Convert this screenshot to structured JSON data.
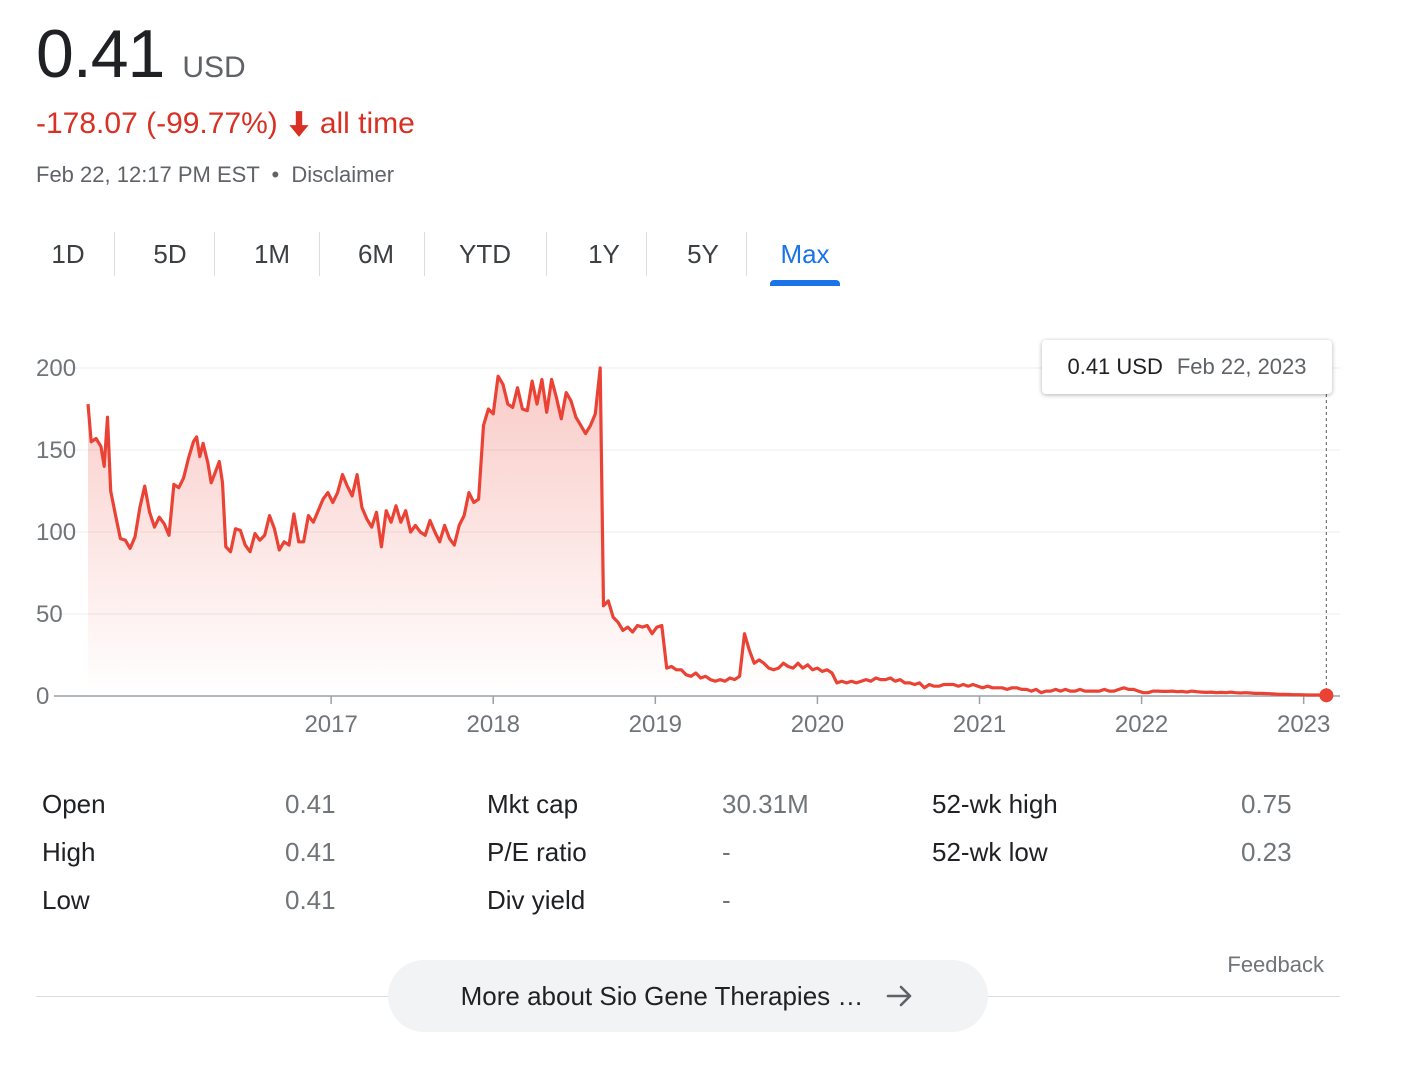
{
  "quote": {
    "price": "0.41",
    "currency": "USD",
    "change": "-178.07 (-99.77%)",
    "change_period": "all time",
    "timestamp": "Feb 22, 12:17 PM EST",
    "separator": "•",
    "disclaimer": "Disclaimer",
    "down_color": "#d93025"
  },
  "tabs": [
    {
      "label": "1D"
    },
    {
      "label": "5D"
    },
    {
      "label": "1M"
    },
    {
      "label": "6M"
    },
    {
      "label": "YTD"
    },
    {
      "label": "1Y"
    },
    {
      "label": "5Y"
    },
    {
      "label": "Max",
      "active": true
    }
  ],
  "tooltip": {
    "value": "0.41 USD",
    "date": "Feb 22, 2023"
  },
  "stats": [
    {
      "label": "Open",
      "value": "0.41"
    },
    {
      "label": "High",
      "value": "0.41"
    },
    {
      "label": "Low",
      "value": "0.41"
    },
    {
      "label": "Mkt cap",
      "value": "30.31M"
    },
    {
      "label": "P/E ratio",
      "value": "-"
    },
    {
      "label": "Div yield",
      "value": "-"
    },
    {
      "label": "52-wk high",
      "value": "0.75"
    },
    {
      "label": "52-wk low",
      "value": "0.23"
    }
  ],
  "footer": {
    "feedback": "Feedback",
    "more_button": "More about Sio Gene Therapies …",
    "arrow_icon": "arrow-right-icon"
  },
  "chart_data": {
    "type": "area",
    "title": "",
    "xlabel": "",
    "ylabel": "",
    "ylim": [
      0,
      200
    ],
    "xlim": [
      2015.5,
      2023.15
    ],
    "yticks": [
      0,
      50,
      100,
      150,
      200
    ],
    "xticks": [
      "2017",
      "2018",
      "2019",
      "2020",
      "2021",
      "2022",
      "2023"
    ],
    "grid": true,
    "line_color": "#ea4335",
    "series": [
      {
        "points": [
          [
            2015.5,
            178
          ],
          [
            2015.52,
            155
          ],
          [
            2015.55,
            157
          ],
          [
            2015.58,
            152
          ],
          [
            2015.6,
            140
          ],
          [
            2015.62,
            170
          ],
          [
            2015.64,
            125
          ],
          [
            2015.67,
            110
          ],
          [
            2015.7,
            96
          ],
          [
            2015.73,
            95
          ],
          [
            2015.76,
            90
          ],
          [
            2015.79,
            97
          ],
          [
            2015.82,
            115
          ],
          [
            2015.85,
            128
          ],
          [
            2015.88,
            112
          ],
          [
            2015.91,
            103
          ],
          [
            2015.94,
            109
          ],
          [
            2015.97,
            105
          ],
          [
            2016.0,
            98
          ],
          [
            2016.03,
            129
          ],
          [
            2016.06,
            127
          ],
          [
            2016.09,
            133
          ],
          [
            2016.12,
            145
          ],
          [
            2016.15,
            155
          ],
          [
            2016.17,
            158
          ],
          [
            2016.19,
            146
          ],
          [
            2016.21,
            154
          ],
          [
            2016.24,
            142
          ],
          [
            2016.26,
            130
          ],
          [
            2016.28,
            135
          ],
          [
            2016.31,
            143
          ],
          [
            2016.33,
            130
          ],
          [
            2016.35,
            91
          ],
          [
            2016.38,
            88
          ],
          [
            2016.41,
            102
          ],
          [
            2016.44,
            101
          ],
          [
            2016.47,
            92
          ],
          [
            2016.5,
            88
          ],
          [
            2016.53,
            99
          ],
          [
            2016.56,
            95
          ],
          [
            2016.59,
            98
          ],
          [
            2016.62,
            110
          ],
          [
            2016.65,
            102
          ],
          [
            2016.68,
            89
          ],
          [
            2016.71,
            94
          ],
          [
            2016.74,
            92
          ],
          [
            2016.77,
            111
          ],
          [
            2016.8,
            94
          ],
          [
            2016.83,
            94
          ],
          [
            2016.86,
            110
          ],
          [
            2016.89,
            106
          ],
          [
            2016.92,
            113
          ],
          [
            2016.95,
            120
          ],
          [
            2016.98,
            124
          ],
          [
            2017.01,
            118
          ],
          [
            2017.04,
            124
          ],
          [
            2017.07,
            135
          ],
          [
            2017.1,
            128
          ],
          [
            2017.13,
            122
          ],
          [
            2017.16,
            135
          ],
          [
            2017.19,
            115
          ],
          [
            2017.22,
            108
          ],
          [
            2017.25,
            103
          ],
          [
            2017.28,
            112
          ],
          [
            2017.31,
            91
          ],
          [
            2017.34,
            113
          ],
          [
            2017.37,
            106
          ],
          [
            2017.4,
            116
          ],
          [
            2017.43,
            106
          ],
          [
            2017.46,
            113
          ],
          [
            2017.49,
            100
          ],
          [
            2017.52,
            104
          ],
          [
            2017.55,
            100
          ],
          [
            2017.58,
            98
          ],
          [
            2017.61,
            107
          ],
          [
            2017.64,
            100
          ],
          [
            2017.67,
            94
          ],
          [
            2017.7,
            104
          ],
          [
            2017.73,
            96
          ],
          [
            2017.76,
            92
          ],
          [
            2017.79,
            104
          ],
          [
            2017.82,
            110
          ],
          [
            2017.85,
            124
          ],
          [
            2017.88,
            118
          ],
          [
            2017.91,
            120
          ],
          [
            2017.94,
            165
          ],
          [
            2017.97,
            175
          ],
          [
            2018.0,
            172
          ],
          [
            2018.03,
            195
          ],
          [
            2018.06,
            190
          ],
          [
            2018.09,
            178
          ],
          [
            2018.12,
            176
          ],
          [
            2018.15,
            188
          ],
          [
            2018.18,
            175
          ],
          [
            2018.21,
            174
          ],
          [
            2018.24,
            192
          ],
          [
            2018.27,
            178
          ],
          [
            2018.3,
            193
          ],
          [
            2018.33,
            173
          ],
          [
            2018.36,
            193
          ],
          [
            2018.39,
            182
          ],
          [
            2018.42,
            169
          ],
          [
            2018.45,
            185
          ],
          [
            2018.48,
            180
          ],
          [
            2018.51,
            170
          ],
          [
            2018.54,
            165
          ],
          [
            2018.57,
            160
          ],
          [
            2018.6,
            165
          ],
          [
            2018.63,
            172
          ],
          [
            2018.66,
            200
          ],
          [
            2018.68,
            55
          ],
          [
            2018.71,
            58
          ],
          [
            2018.74,
            48
          ],
          [
            2018.77,
            45
          ],
          [
            2018.8,
            40
          ],
          [
            2018.83,
            42
          ],
          [
            2018.86,
            39
          ],
          [
            2018.89,
            43
          ],
          [
            2018.92,
            42
          ],
          [
            2018.95,
            43
          ],
          [
            2018.98,
            38
          ],
          [
            2019.01,
            42
          ],
          [
            2019.04,
            43
          ],
          [
            2019.07,
            17
          ],
          [
            2019.1,
            18
          ],
          [
            2019.13,
            16
          ],
          [
            2019.16,
            16
          ],
          [
            2019.19,
            13
          ],
          [
            2019.22,
            12
          ],
          [
            2019.25,
            14
          ],
          [
            2019.28,
            11
          ],
          [
            2019.31,
            12
          ],
          [
            2019.34,
            10
          ],
          [
            2019.37,
            9
          ],
          [
            2019.4,
            10
          ],
          [
            2019.43,
            9
          ],
          [
            2019.46,
            11
          ],
          [
            2019.49,
            10
          ],
          [
            2019.52,
            12
          ],
          [
            2019.55,
            38
          ],
          [
            2019.58,
            28
          ],
          [
            2019.61,
            20
          ],
          [
            2019.64,
            22
          ],
          [
            2019.67,
            20
          ],
          [
            2019.7,
            17
          ],
          [
            2019.73,
            16
          ],
          [
            2019.76,
            17
          ],
          [
            2019.79,
            20
          ],
          [
            2019.82,
            18
          ],
          [
            2019.85,
            17
          ],
          [
            2019.88,
            20
          ],
          [
            2019.91,
            17
          ],
          [
            2019.94,
            19
          ],
          [
            2019.97,
            16
          ],
          [
            2020.0,
            17
          ],
          [
            2020.03,
            15
          ],
          [
            2020.06,
            16
          ],
          [
            2020.09,
            14
          ],
          [
            2020.12,
            8
          ],
          [
            2020.15,
            9
          ],
          [
            2020.18,
            8
          ],
          [
            2020.21,
            9
          ],
          [
            2020.24,
            8
          ],
          [
            2020.27,
            9
          ],
          [
            2020.3,
            10
          ],
          [
            2020.33,
            9
          ],
          [
            2020.36,
            11
          ],
          [
            2020.39,
            10
          ],
          [
            2020.42,
            10
          ],
          [
            2020.45,
            11
          ],
          [
            2020.48,
            9
          ],
          [
            2020.51,
            10
          ],
          [
            2020.54,
            8
          ],
          [
            2020.57,
            8
          ],
          [
            2020.6,
            7
          ],
          [
            2020.63,
            8
          ],
          [
            2020.66,
            5
          ],
          [
            2020.69,
            7
          ],
          [
            2020.72,
            6
          ],
          [
            2020.75,
            6
          ],
          [
            2020.78,
            7
          ],
          [
            2020.81,
            7
          ],
          [
            2020.84,
            7
          ],
          [
            2020.87,
            6
          ],
          [
            2020.9,
            7
          ],
          [
            2020.93,
            6
          ],
          [
            2020.96,
            7
          ],
          [
            2020.99,
            6
          ],
          [
            2021.02,
            5
          ],
          [
            2021.05,
            6
          ],
          [
            2021.08,
            5
          ],
          [
            2021.11,
            5
          ],
          [
            2021.14,
            5
          ],
          [
            2021.17,
            4
          ],
          [
            2021.2,
            5
          ],
          [
            2021.23,
            5
          ],
          [
            2021.26,
            4
          ],
          [
            2021.29,
            4
          ],
          [
            2021.32,
            3
          ],
          [
            2021.35,
            4
          ],
          [
            2021.38,
            2
          ],
          [
            2021.41,
            3
          ],
          [
            2021.44,
            3
          ],
          [
            2021.47,
            4
          ],
          [
            2021.5,
            3
          ],
          [
            2021.53,
            4
          ],
          [
            2021.56,
            3
          ],
          [
            2021.59,
            3
          ],
          [
            2021.62,
            4
          ],
          [
            2021.65,
            3
          ],
          [
            2021.68,
            3
          ],
          [
            2021.71,
            3
          ],
          [
            2021.74,
            3
          ],
          [
            2021.77,
            4
          ],
          [
            2021.8,
            3
          ],
          [
            2021.83,
            3
          ],
          [
            2021.86,
            4
          ],
          [
            2021.89,
            5
          ],
          [
            2021.92,
            4
          ],
          [
            2021.95,
            4
          ],
          [
            2021.98,
            3
          ],
          [
            2022.01,
            2
          ],
          [
            2022.04,
            2
          ],
          [
            2022.07,
            3
          ],
          [
            2022.1,
            3
          ],
          [
            2022.13,
            2.8
          ],
          [
            2022.16,
            2.8
          ],
          [
            2022.19,
            3
          ],
          [
            2022.22,
            2.6
          ],
          [
            2022.25,
            2.8
          ],
          [
            2022.28,
            2.4
          ],
          [
            2022.31,
            3
          ],
          [
            2022.34,
            2.6
          ],
          [
            2022.37,
            2.4
          ],
          [
            2022.4,
            2.2
          ],
          [
            2022.43,
            2.4
          ],
          [
            2022.46,
            2
          ],
          [
            2022.49,
            2.2
          ],
          [
            2022.52,
            2
          ],
          [
            2022.55,
            2.4
          ],
          [
            2022.58,
            2
          ],
          [
            2022.61,
            1.8
          ],
          [
            2022.64,
            2
          ],
          [
            2022.67,
            1.8
          ],
          [
            2022.7,
            1.6
          ],
          [
            2022.73,
            1.6
          ],
          [
            2022.76,
            1.5
          ],
          [
            2022.79,
            1.4
          ],
          [
            2022.82,
            1.2
          ],
          [
            2022.85,
            1
          ],
          [
            2022.88,
            1
          ],
          [
            2022.91,
            0.9
          ],
          [
            2022.94,
            0.8
          ],
          [
            2022.97,
            0.8
          ],
          [
            2023.0,
            0.7
          ],
          [
            2023.03,
            0.6
          ],
          [
            2023.06,
            0.6
          ],
          [
            2023.09,
            0.6
          ],
          [
            2023.12,
            0.5
          ],
          [
            2023.14,
            0.41
          ]
        ]
      }
    ]
  }
}
